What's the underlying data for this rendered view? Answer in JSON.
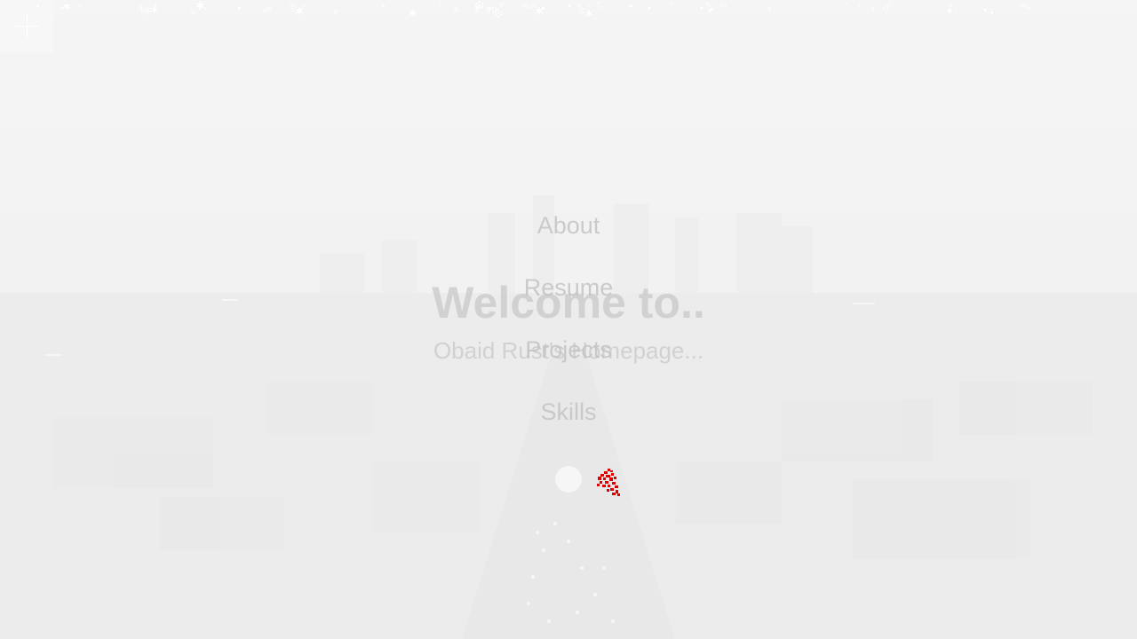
{
  "menu": {
    "items": [
      {
        "label": "About"
      },
      {
        "label": "Resume"
      },
      {
        "label": "Projects"
      },
      {
        "label": "Skills"
      }
    ]
  },
  "hero": {
    "title": "Welcome to..",
    "subtitle": "Obaid Rust's Homepage..."
  },
  "icons": {
    "close": "plus-close-icon",
    "social_1": "circle-social-icon",
    "social_2": "red-logo-icon"
  },
  "colors": {
    "background": "#efefef",
    "menu_text": "#c3c3c3",
    "accent_red": "#e10000"
  }
}
